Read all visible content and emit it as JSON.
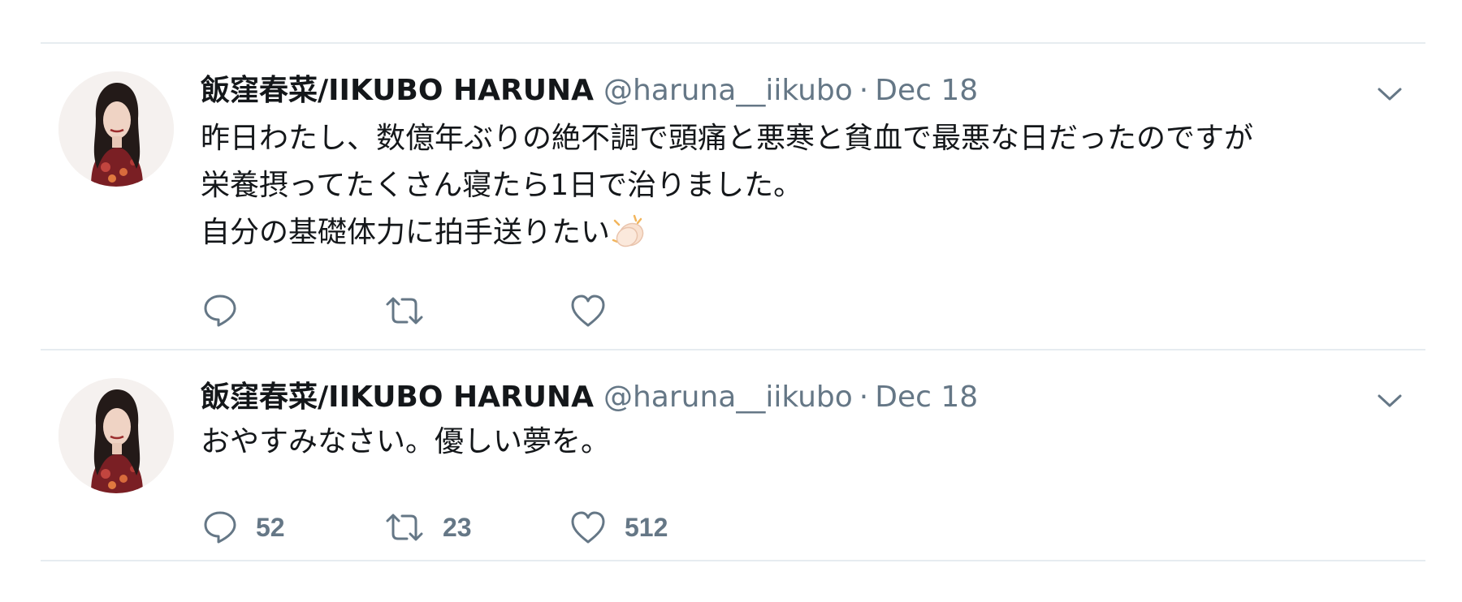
{
  "colors": {
    "text_primary": "#14171a",
    "text_secondary": "#657786",
    "divider": "#e6ecf0"
  },
  "tweets": [
    {
      "display_name": "飯窪春菜/IIKUBO HARUNA",
      "handle": "@haruna__iikubo",
      "separator": "·",
      "date": "Dec 18",
      "text": "昨日わたし、数億年ぶりの絶不調で頭痛と悪寒と貧血で最悪な日だったのですが\n栄養摂ってたくさん寝たら1日で治りました。\n自分の基礎体力に拍手送りたい",
      "emoji": "clapping-hands-emoji",
      "reply_count": "",
      "retweet_count": "",
      "like_count": ""
    },
    {
      "display_name": "飯窪春菜/IIKUBO HARUNA",
      "handle": "@haruna__iikubo",
      "separator": "·",
      "date": "Dec 18",
      "text": "おやすみなさい。優しい夢を。",
      "reply_count": "52",
      "retweet_count": "23",
      "like_count": "512"
    }
  ],
  "icons": {
    "reply": "reply-icon",
    "retweet": "retweet-icon",
    "like": "heart-icon",
    "caret": "chevron-down-icon",
    "avatar": "avatar"
  }
}
